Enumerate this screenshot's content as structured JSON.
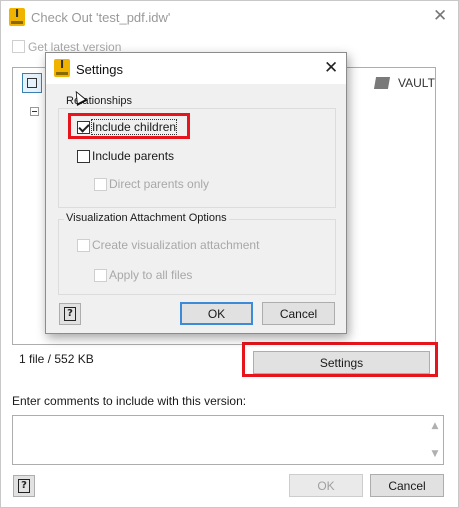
{
  "window": {
    "title": "Check Out 'test_pdf.idw'",
    "get_latest_label": "Get latest version",
    "get_latest_checked": false,
    "vault_label": "VAULT",
    "file_summary": "1 file / 552 KB",
    "settings_button": "Settings",
    "comments_label": "Enter comments to include with this version:",
    "comments_value": "",
    "ok_button": "OK",
    "cancel_button": "Cancel",
    "help_icon": "help-icon",
    "close_icon": "close-icon"
  },
  "settings_dialog": {
    "title": "Settings",
    "relationships_group": "Relationships",
    "include_children_label": "Include children",
    "include_children_checked": true,
    "include_parents_label": "Include parents",
    "include_parents_checked": false,
    "direct_parents_label": "Direct parents only",
    "visualization_group": "Visualization Attachment Options",
    "create_visualization_label": "Create visualization attachment",
    "apply_all_label": "Apply to all files",
    "ok_button": "OK",
    "cancel_button": "Cancel"
  },
  "colors": {
    "highlight": "#e8141c",
    "focus_border": "#3c8ad8",
    "app_icon": "#f0b400"
  }
}
